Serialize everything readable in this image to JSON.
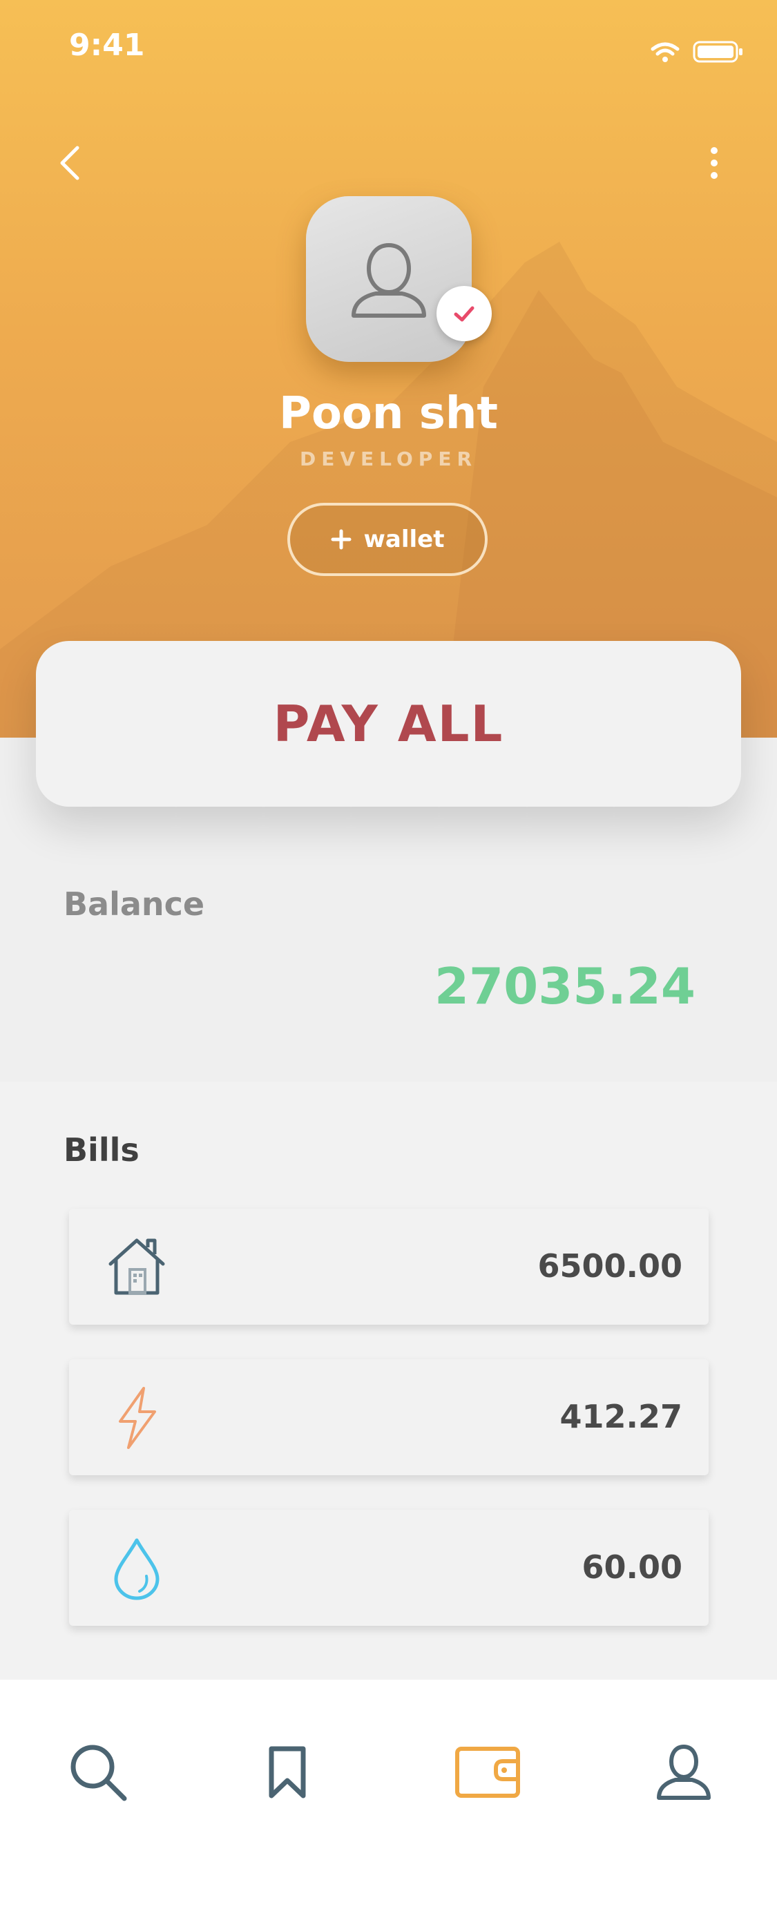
{
  "status_bar": {
    "time": "9:41"
  },
  "profile": {
    "name": "Poon sht",
    "role": "DEVELOPER",
    "wallet_button_label": "wallet"
  },
  "actions": {
    "pay_all_label": "PAY ALL"
  },
  "balance": {
    "label": "Balance",
    "value": "27035.24"
  },
  "bills": {
    "title": "Bills",
    "items": [
      {
        "icon": "house-icon",
        "amount": "6500.00"
      },
      {
        "icon": "lightning-icon",
        "amount": "412.27"
      },
      {
        "icon": "water-drop-icon",
        "amount": "60.00"
      }
    ]
  },
  "tab_bar": {
    "items": [
      {
        "icon": "search-icon",
        "active": false
      },
      {
        "icon": "bookmark-icon",
        "active": false
      },
      {
        "icon": "wallet-icon",
        "active": true
      },
      {
        "icon": "profile-icon",
        "active": false
      }
    ]
  },
  "colors": {
    "header_gradient_top": "#f6bf55",
    "header_gradient_bottom": "#e29a4e",
    "pay_all_text": "#b0484e",
    "balance_value": "#6fcf94",
    "active_tab": "#f0a844",
    "inactive_tab": "#4b6472"
  }
}
